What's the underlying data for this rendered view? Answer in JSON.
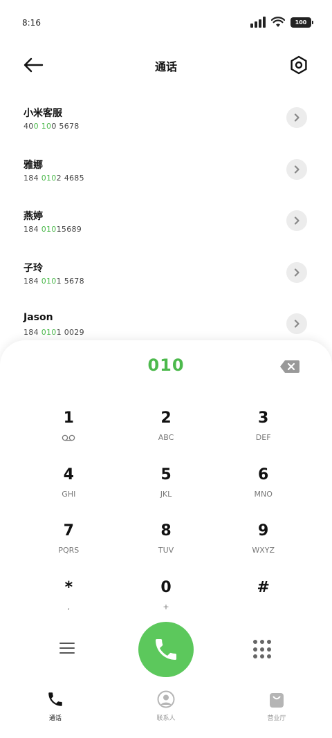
{
  "status": {
    "time": "8:16",
    "battery": "100"
  },
  "header": {
    "title": "通话"
  },
  "contacts": [
    {
      "name": "小米客服",
      "num_pre": "40",
      "num_hl": "0 10",
      "num_post": "0 5678"
    },
    {
      "name": "雅娜",
      "num_pre": "184 ",
      "num_hl": "010",
      "num_post": "2 4685"
    },
    {
      "name": "燕婷",
      "num_pre": "184 ",
      "num_hl": "010",
      "num_post": "15689"
    },
    {
      "name": "子玲",
      "num_pre": "184 ",
      "num_hl": "010",
      "num_post": "1 5678"
    },
    {
      "name": "Jason",
      "num_pre": "184 ",
      "num_hl": "010",
      "num_post": "1 0029"
    }
  ],
  "dialer": {
    "display": "010",
    "keys": [
      {
        "digit": "1",
        "letters": ""
      },
      {
        "digit": "2",
        "letters": "ABC"
      },
      {
        "digit": "3",
        "letters": "DEF"
      },
      {
        "digit": "4",
        "letters": "GHI"
      },
      {
        "digit": "5",
        "letters": "JKL"
      },
      {
        "digit": "6",
        "letters": "MNO"
      },
      {
        "digit": "7",
        "letters": "PQRS"
      },
      {
        "digit": "8",
        "letters": "TUV"
      },
      {
        "digit": "9",
        "letters": "WXYZ"
      },
      {
        "digit": "*",
        "letters": ","
      },
      {
        "digit": "0",
        "letters": "+"
      },
      {
        "digit": "#",
        "letters": ""
      }
    ]
  },
  "tabs": [
    {
      "label": "通话",
      "icon": "phone-icon",
      "active": true
    },
    {
      "label": "联系人",
      "icon": "contacts-icon",
      "active": false
    },
    {
      "label": "营业厅",
      "icon": "store-bag-icon",
      "active": false
    }
  ],
  "colors": {
    "accent": "#4cb94c",
    "call_button": "#5cc85c"
  }
}
